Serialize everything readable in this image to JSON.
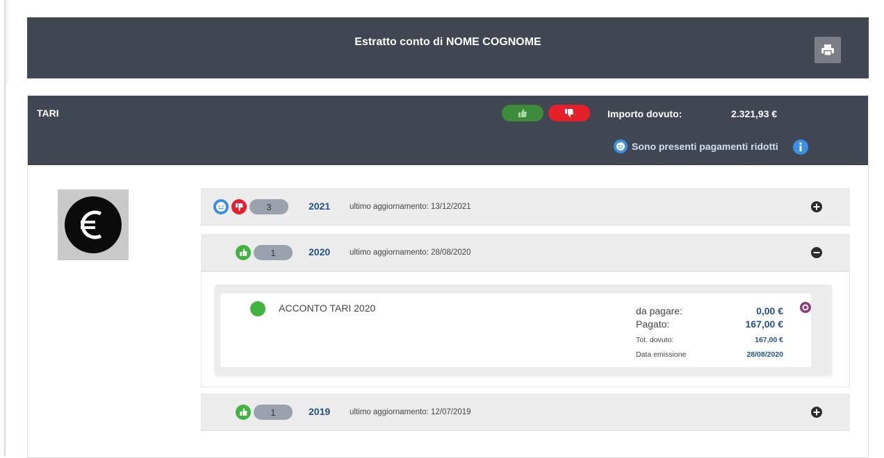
{
  "header": {
    "title": "Estratto conto di NOME COGNOME",
    "print_icon": "print-icon"
  },
  "tari": {
    "label": "TARI",
    "importo_label": "Importo dovuto:",
    "importo_value": "2.321,93 €",
    "ridotti_text": "Sono presenti pagamenti ridotti",
    "colors": {
      "header_bg": "#404652",
      "green": "#3c8c3c",
      "red": "#e5202b",
      "link": "#21508a"
    }
  },
  "years": [
    {
      "year": "2021",
      "count": "3",
      "updated": "ultimo aggiornamento: 13/12/2021",
      "expanded": false
    },
    {
      "year": "2020",
      "count": "1",
      "updated": "ultimo aggiornamento: 28/08/2020",
      "expanded": true
    },
    {
      "year": "2019",
      "count": "1",
      "updated": "ultimo aggiornamento: 12/07/2019",
      "expanded": false
    }
  ],
  "detail": {
    "voce": "ACCONTO TARI 2020",
    "da_pagare_label": "da pagare:",
    "da_pagare_value": "0,00 €",
    "pagato_label": "Pagato:",
    "pagato_value": "167,00 €",
    "tot_label": "Tot. dovuto:",
    "tot_value": "167,00 €",
    "data_label": "Data emissione",
    "data_value": "28/08/2020"
  }
}
